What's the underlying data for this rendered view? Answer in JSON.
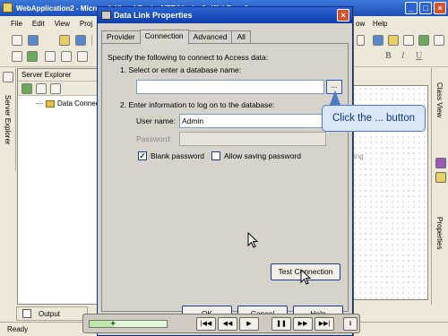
{
  "ide": {
    "title": "WebApplication2 - Microsoft Visual Basic .NET [design] - WebForm1.aspx",
    "menu": [
      "File",
      "Edit",
      "View",
      "Proj",
      "ow",
      "Help"
    ],
    "server_explorer": {
      "title": "Server Explorer",
      "node": "Data Connec"
    },
    "left_tab": "Server Explorer",
    "right_tabs": [
      "Class View",
      "Properties"
    ],
    "design_fragment": "ing",
    "output_tab": "Output",
    "status": "Ready"
  },
  "dialog": {
    "title": "Data Link Properties",
    "tabs": [
      "Provider",
      "Connection",
      "Advanced",
      "All"
    ],
    "active_tab": "Connection",
    "intro": "Specify the following to connect to Access data:",
    "step1": "1. Select or enter a database name:",
    "database_value": "",
    "ellipsis_label": "...",
    "step2": "2. Enter information to log on to the database:",
    "username_label": "User name:",
    "username_value": "Admin",
    "password_label": "Password:",
    "password_value": "",
    "blank_password_label": "Blank password",
    "blank_password_checked": true,
    "allow_saving_label": "Allow saving password",
    "allow_saving_checked": false,
    "test_connection_label": "Test Connection",
    "ok_label": "OK",
    "cancel_label": "Cancel",
    "help_label": "Help"
  },
  "callout": {
    "text": "Click the ... button"
  },
  "player": {
    "progress": 0.3
  },
  "icons": {
    "checkmark": "check-icon",
    "play": "play-icon",
    "pause": "pause-icon",
    "info": "info-icon"
  },
  "colors": {
    "title_blue": "#0e3eaa",
    "callout_bg": "#d9e6f6",
    "callout_text": "#123a7a"
  }
}
